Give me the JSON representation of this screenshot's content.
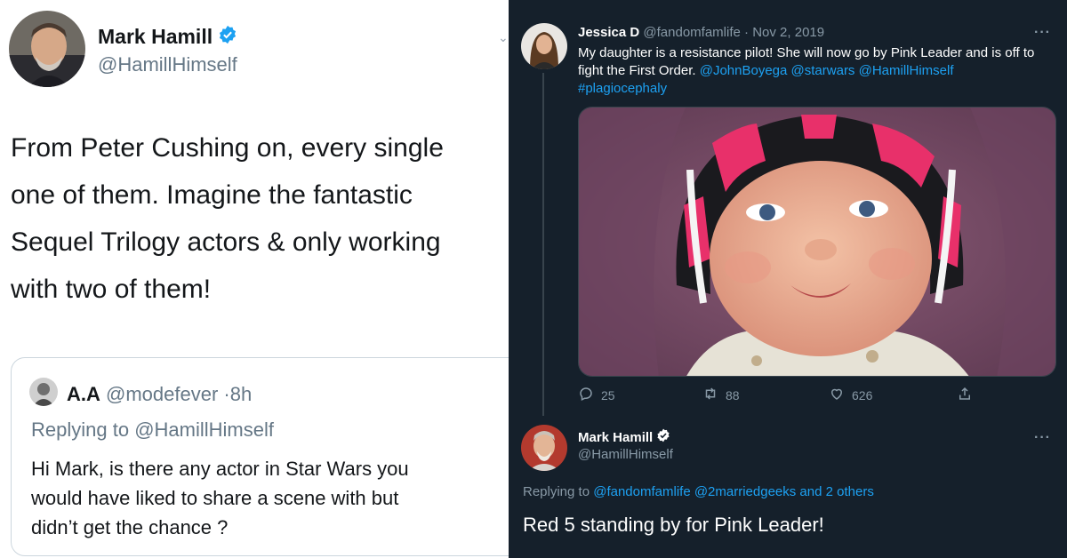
{
  "left_tweet": {
    "author_name": "Mark Hamill",
    "author_handle": "@HamillHimself",
    "text": "From Peter Cushing on, every single\none of them. Imagine the fantastic\nSequel Trilogy actors & only working\nwith two of them!",
    "quoted": {
      "author_name": "A.A",
      "author_handle": "@modefever",
      "separator": "·",
      "time": "8h",
      "replying_prefix": "Replying to",
      "replying_mention": "@HamillHimself",
      "text": "Hi Mark, is there any actor in Star Wars you\nwould have liked to share a scene with but\ndidn’t get the chance ?"
    }
  },
  "right_thread": {
    "first": {
      "author_name": "Jessica D",
      "author_handle": "@fandomfamlife",
      "separator": "·",
      "date": "Nov 2, 2019",
      "text": "My daughter is a resistance pilot! She will now go by Pink Leader and is off to fight the First Order.",
      "mentions": [
        "@JohnBoyega",
        "@starwars",
        "@HamillHimself"
      ],
      "hashtag": "#plagiocephaly",
      "replies": "25",
      "retweets": "88",
      "likes": "626"
    },
    "reply": {
      "author_name": "Mark Hamill",
      "author_handle": "@HamillHimself",
      "replying_prefix": "Replying to",
      "replying_targets": "@fandomfamlife @2marriedgeeks and 2 others",
      "text": "Red 5 standing by for Pink Leader!"
    },
    "more_label": "···"
  },
  "colors": {
    "accent": "#1da1f2",
    "dark_bg": "#15202b",
    "muted_dark": "#8899a6",
    "muted_light": "#657786",
    "helmet_pink": "#e8306a"
  },
  "icons": [
    "verified-badge-icon",
    "reply-icon",
    "retweet-icon",
    "like-icon",
    "share-icon",
    "more-icon",
    "chevron-down-icon"
  ]
}
